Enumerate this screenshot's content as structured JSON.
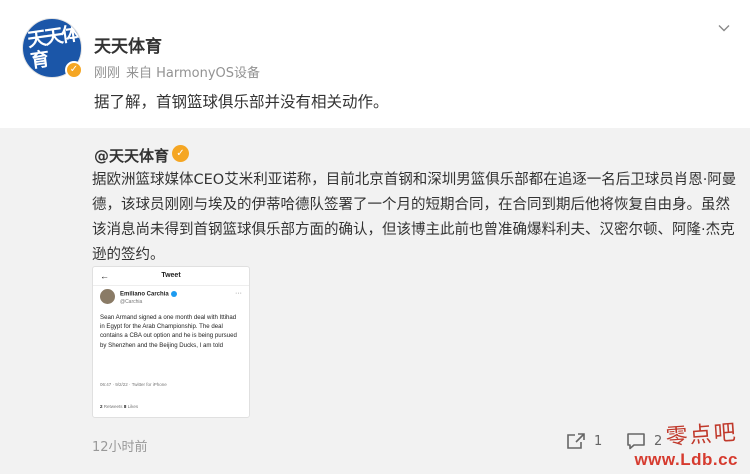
{
  "post": {
    "avatar_text": "天天体育",
    "user_name": "天天体育",
    "time": "刚刚",
    "source": "来自 HarmonyOS设备",
    "text": "据了解，首钢篮球俱乐部并没有相关动作。"
  },
  "repost": {
    "user": "@天天体育",
    "text": "据欧洲篮球媒体CEO艾米利亚诺称，目前北京首钢和深圳男篮俱乐部都在追逐一名后卫球员肖恩·阿曼德，该球员刚刚与埃及的伊蒂哈德队签署了一个月的短期合同，在合同到期后他将恢复自由身。虽然该消息尚未得到首钢篮球俱乐部方面的确认，但该博主此前也曾准确爆料利夫、汉密尔顿、阿隆·杰克逊的签约。",
    "tweet": {
      "title": "Tweet",
      "author": "Emiliano Carchia",
      "handle": "@Carchia",
      "body": "Sean Armand signed a one month deal with Ittihad in Egypt for the Arab Championship. The deal contains a CBA out option and he is being pursued by Shenzhen and the Beijing Ducks, I am told",
      "time": "06:47 · 9/2/22 · Twitter for iPhone",
      "retweets": "2",
      "retweets_label": "Retweets",
      "likes": "8",
      "likes_label": "Likes"
    },
    "timestamp": "12小时前",
    "share_count": "1",
    "comment_count": "2"
  },
  "watermark": {
    "cn": "零点吧",
    "url": "www.Ldb.cc"
  },
  "colors": {
    "avatar_bg": "#1b56a8",
    "verified": "#f5a623",
    "repost_bg": "#f2f2f2",
    "watermark": "#d63b2f"
  }
}
